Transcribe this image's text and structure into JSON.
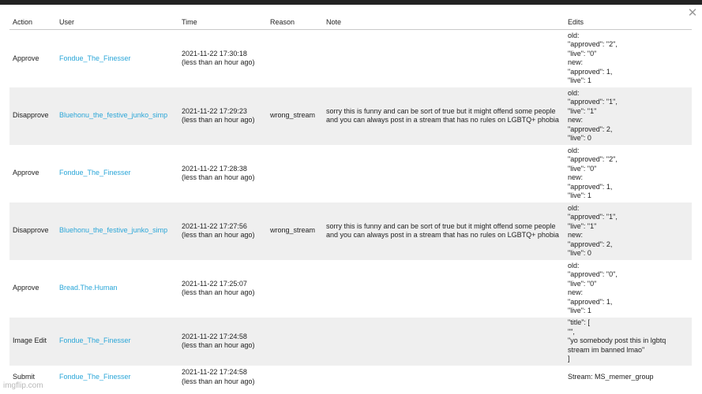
{
  "header": {
    "action": "Action",
    "user": "User",
    "time": "Time",
    "reason": "Reason",
    "note": "Note",
    "edits": "Edits"
  },
  "rows": [
    {
      "action": "Approve",
      "user": "Fondue_The_Finesser",
      "time": "2021-11-22 17:30:18\n(less than an hour ago)",
      "reason": "",
      "note": "",
      "edits": "old:\n\"approved\": \"2\",\n\"live\": \"0\"\nnew:\n\"approved\": 1,\n\"live\": 1"
    },
    {
      "action": "Disapprove",
      "user": "Bluehonu_the_festive_junko_simp",
      "time": "2021-11-22 17:29:23\n(less than an hour ago)",
      "reason": "wrong_stream",
      "note": "sorry this is funny and can be sort of true but it might offend some people and you can always post in a stream that has no rules on LGBTQ+ phobia",
      "edits": "old:\n\"approved\": \"1\",\n\"live\": \"1\"\nnew:\n\"approved\": 2,\n\"live\": 0"
    },
    {
      "action": "Approve",
      "user": "Fondue_The_Finesser",
      "time": "2021-11-22 17:28:38\n(less than an hour ago)",
      "reason": "",
      "note": "",
      "edits": "old:\n\"approved\": \"2\",\n\"live\": \"0\"\nnew:\n\"approved\": 1,\n\"live\": 1"
    },
    {
      "action": "Disapprove",
      "user": "Bluehonu_the_festive_junko_simp",
      "time": "2021-11-22 17:27:56\n(less than an hour ago)",
      "reason": "wrong_stream",
      "note": "sorry this is funny and can be sort of true but it might offend some people and you can always post in a stream that has no rules on LGBTQ+ phobia",
      "edits": "old:\n\"approved\": \"1\",\n\"live\": \"1\"\nnew:\n\"approved\": 2,\n\"live\": 0"
    },
    {
      "action": "Approve",
      "user": "Bread.The.Human",
      "time": "2021-11-22 17:25:07\n(less than an hour ago)",
      "reason": "",
      "note": "",
      "edits": "old:\n\"approved\": \"0\",\n\"live\": \"0\"\nnew:\n\"approved\": 1,\n\"live\": 1"
    },
    {
      "action": "Image Edit",
      "user": "Fondue_The_Finesser",
      "time": "2021-11-22 17:24:58\n(less than an hour ago)",
      "reason": "",
      "note": "",
      "edits": "\"title\": [\n\"\",\n\"yo somebody post this in lgbtq stream im banned lmao\"\n]"
    },
    {
      "action": "Submit",
      "user": "Fondue_The_Finesser",
      "time": "2021-11-22 17:24:58\n(less than an hour ago)",
      "reason": "",
      "note": "",
      "edits": "Stream: MS_memer_group"
    }
  ],
  "close_icon": "close-icon",
  "watermark": "imgflip.com"
}
